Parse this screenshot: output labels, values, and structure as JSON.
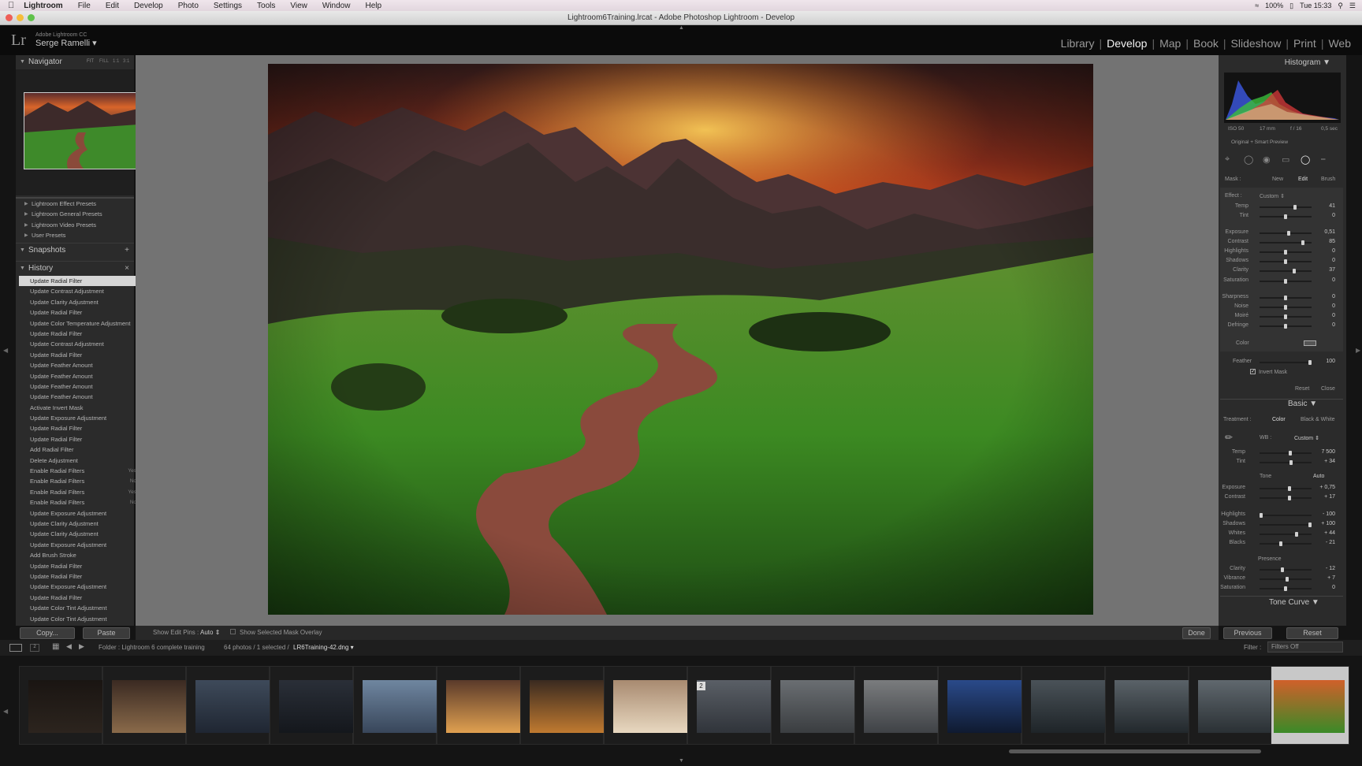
{
  "menubar": {
    "app": "Lightroom",
    "items": [
      "File",
      "Edit",
      "Develop",
      "Photo",
      "Settings",
      "Tools",
      "View",
      "Window",
      "Help"
    ],
    "battery": "100%",
    "clock": "Tue 15:33"
  },
  "window": {
    "title": "Lightroom6Training.lrcat - Adobe Photoshop Lightroom - Develop"
  },
  "identity": {
    "product": "Adobe Lightroom CC",
    "user": "Serge Ramelli"
  },
  "modules": {
    "items": [
      {
        "label": "Library",
        "active": false
      },
      {
        "label": "Develop",
        "active": true
      },
      {
        "label": "Map",
        "active": false
      },
      {
        "label": "Book",
        "active": false
      },
      {
        "label": "Slideshow",
        "active": false
      },
      {
        "label": "Print",
        "active": false
      },
      {
        "label": "Web",
        "active": false
      }
    ]
  },
  "left": {
    "navigator": {
      "title": "Navigator",
      "zoom": [
        "FIT",
        "FILL",
        "1:1",
        "3:1"
      ]
    },
    "presets": [
      "Lightroom Effect Presets",
      "Lightroom General Presets",
      "Lightroom Video Presets",
      "User Presets"
    ],
    "snapshots": {
      "title": "Snapshots"
    },
    "history": {
      "title": "History",
      "items": [
        {
          "label": "Update Radial Filter",
          "val": ""
        },
        {
          "label": "Update Contrast Adjustment",
          "val": ""
        },
        {
          "label": "Update Clarity Adjustment",
          "val": ""
        },
        {
          "label": "Update Radial Filter",
          "val": ""
        },
        {
          "label": "Update Color Temperature Adjustment",
          "val": ""
        },
        {
          "label": "Update Radial Filter",
          "val": ""
        },
        {
          "label": "Update Contrast Adjustment",
          "val": ""
        },
        {
          "label": "Update Radial Filter",
          "val": ""
        },
        {
          "label": "Update Feather Amount",
          "val": ""
        },
        {
          "label": "Update Feather Amount",
          "val": ""
        },
        {
          "label": "Update Feather Amount",
          "val": ""
        },
        {
          "label": "Update Feather Amount",
          "val": ""
        },
        {
          "label": "Activate Invert Mask",
          "val": ""
        },
        {
          "label": "Update Exposure Adjustment",
          "val": ""
        },
        {
          "label": "Update Radial Filter",
          "val": ""
        },
        {
          "label": "Update Radial Filter",
          "val": ""
        },
        {
          "label": "Add Radial Filter",
          "val": ""
        },
        {
          "label": "Delete Adjustment",
          "val": ""
        },
        {
          "label": "Enable Radial Filters",
          "val": "Yes"
        },
        {
          "label": "Enable Radial Filters",
          "val": "No"
        },
        {
          "label": "Enable Radial Filters",
          "val": "Yes"
        },
        {
          "label": "Enable Radial Filters",
          "val": "No"
        },
        {
          "label": "Update Exposure Adjustment",
          "val": ""
        },
        {
          "label": "Update Clarity Adjustment",
          "val": ""
        },
        {
          "label": "Update Clarity Adjustment",
          "val": ""
        },
        {
          "label": "Update Exposure Adjustment",
          "val": ""
        },
        {
          "label": "Add Brush Stroke",
          "val": ""
        },
        {
          "label": "Update Radial Filter",
          "val": ""
        },
        {
          "label": "Update Radial Filter",
          "val": ""
        },
        {
          "label": "Update Exposure Adjustment",
          "val": ""
        },
        {
          "label": "Update Radial Filter",
          "val": ""
        },
        {
          "label": "Update Color Tint Adjustment",
          "val": ""
        },
        {
          "label": "Update Color Tint Adjustment",
          "val": ""
        }
      ]
    },
    "copy": "Copy...",
    "paste": "Paste"
  },
  "toolbar": {
    "edit_pins_label": "Show Edit Pins :",
    "edit_pins_value": "Auto",
    "mask_overlay": "Show Selected Mask Overlay",
    "done": "Done"
  },
  "right": {
    "histogram": {
      "title": "Histogram",
      "info": [
        "ISO 50",
        "17 mm",
        "f / 16",
        "0,5 sec"
      ],
      "preview": "Original + Smart Preview"
    },
    "mask": {
      "label": "Mask :",
      "new": "New",
      "edit": "Edit",
      "brush": "Brush"
    },
    "effect": {
      "label": "Effect :",
      "preset": "Custom",
      "sliders": [
        {
          "name": "Temp",
          "value": "41",
          "pos": 0.7
        },
        {
          "name": "Tint",
          "value": "0",
          "pos": 0.5
        },
        {
          "name": "Exposure",
          "value": "0,51",
          "pos": 0.56
        },
        {
          "name": "Contrast",
          "value": "85",
          "pos": 0.85
        },
        {
          "name": "Highlights",
          "value": "0",
          "pos": 0.5
        },
        {
          "name": "Shadows",
          "value": "0",
          "pos": 0.5
        },
        {
          "name": "Clarity",
          "value": "37",
          "pos": 0.68
        },
        {
          "name": "Saturation",
          "value": "0",
          "pos": 0.5
        },
        {
          "name": "Sharpness",
          "value": "0",
          "pos": 0.5
        },
        {
          "name": "Noise",
          "value": "0",
          "pos": 0.5
        },
        {
          "name": "Moiré",
          "value": "0",
          "pos": 0.5
        },
        {
          "name": "Defringe",
          "value": "0",
          "pos": 0.5
        }
      ],
      "color_label": "Color",
      "feather_label": "Feather",
      "feather_value": "100",
      "invert_mask": "Invert Mask",
      "reset": "Reset",
      "close": "Close"
    },
    "basic": {
      "title": "Basic",
      "treatment_label": "Treatment :",
      "color": "Color",
      "bw": "Black & White",
      "wb_label": "WB :",
      "wb_value": "Custom",
      "tone_label": "Tone",
      "auto": "Auto",
      "presence_label": "Presence",
      "sliders": [
        {
          "name": "Temp",
          "value": "7 500",
          "pos": 0.6
        },
        {
          "name": "Tint",
          "value": "+ 34",
          "pos": 0.62
        },
        {
          "name": "Exposure",
          "value": "+ 0,75",
          "pos": 0.58
        },
        {
          "name": "Contrast",
          "value": "+ 17",
          "pos": 0.58
        },
        {
          "name": "Highlights",
          "value": "- 100",
          "pos": 0.0
        },
        {
          "name": "Shadows",
          "value": "+ 100",
          "pos": 1.0
        },
        {
          "name": "Whites",
          "value": "+ 44",
          "pos": 0.72
        },
        {
          "name": "Blacks",
          "value": "- 21",
          "pos": 0.4
        },
        {
          "name": "Clarity",
          "value": "- 12",
          "pos": 0.44
        },
        {
          "name": "Vibrance",
          "value": "+ 7",
          "pos": 0.54
        },
        {
          "name": "Saturation",
          "value": "0",
          "pos": 0.5
        }
      ]
    },
    "tone_curve": {
      "title": "Tone Curve"
    },
    "previous": "Previous",
    "reset": "Reset"
  },
  "filmbar": {
    "folder": "Folder : Lightroom 6 complete training",
    "count": "64 photos / 1 selected /",
    "filename": "LR6Training-42.dng",
    "filter_label": "Filter :",
    "filter_value": "Filters Off",
    "pages": [
      "1",
      "2"
    ],
    "badge": "2"
  },
  "colors": {
    "accent": "#f2f2f2",
    "panel": "#2b2b2b",
    "background": "#737373"
  }
}
